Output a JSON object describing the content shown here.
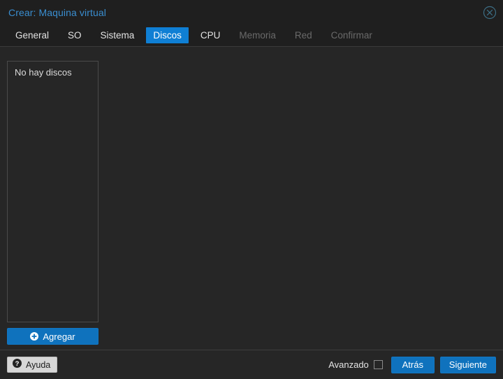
{
  "window": {
    "title": "Crear: Maquina virtual",
    "close_icon": "close-circle-icon",
    "accent_color": "#0f7fd4",
    "title_color": "#3a8ed0",
    "background_color": "#262626",
    "titlebar_color": "#1f1f1f"
  },
  "tabs": [
    {
      "label": "General",
      "active": false,
      "disabled": false
    },
    {
      "label": "SO",
      "active": false,
      "disabled": false
    },
    {
      "label": "Sistema",
      "active": false,
      "disabled": false
    },
    {
      "label": "Discos",
      "active": true,
      "disabled": false
    },
    {
      "label": "CPU",
      "active": false,
      "disabled": false
    },
    {
      "label": "Memoria",
      "active": false,
      "disabled": true
    },
    {
      "label": "Red",
      "active": false,
      "disabled": true
    },
    {
      "label": "Confirmar",
      "active": false,
      "disabled": true
    }
  ],
  "disks_panel": {
    "empty_message": "No hay discos",
    "items": [],
    "add_button": {
      "label": "Agregar",
      "icon": "plus-circle-icon"
    }
  },
  "footer": {
    "help_button": {
      "label": "Ayuda",
      "icon": "question-circle-icon"
    },
    "advanced": {
      "label": "Avanzado",
      "checked": false
    },
    "back_button": {
      "label": "Atrás"
    },
    "next_button": {
      "label": "Siguiente"
    }
  }
}
